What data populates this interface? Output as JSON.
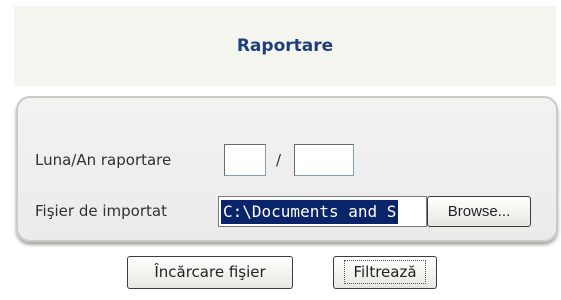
{
  "header": {
    "title": "Raportare"
  },
  "form": {
    "month_year_label": "Luna/An raportare",
    "month_value": "",
    "year_value": "",
    "separator": "/",
    "file_label": "Fişier de importat",
    "file_value": "C:\\Documents and S",
    "browse_label": "Browse..."
  },
  "actions": {
    "upload_label": "Încărcare fişier",
    "filter_label": "Filtrează"
  }
}
